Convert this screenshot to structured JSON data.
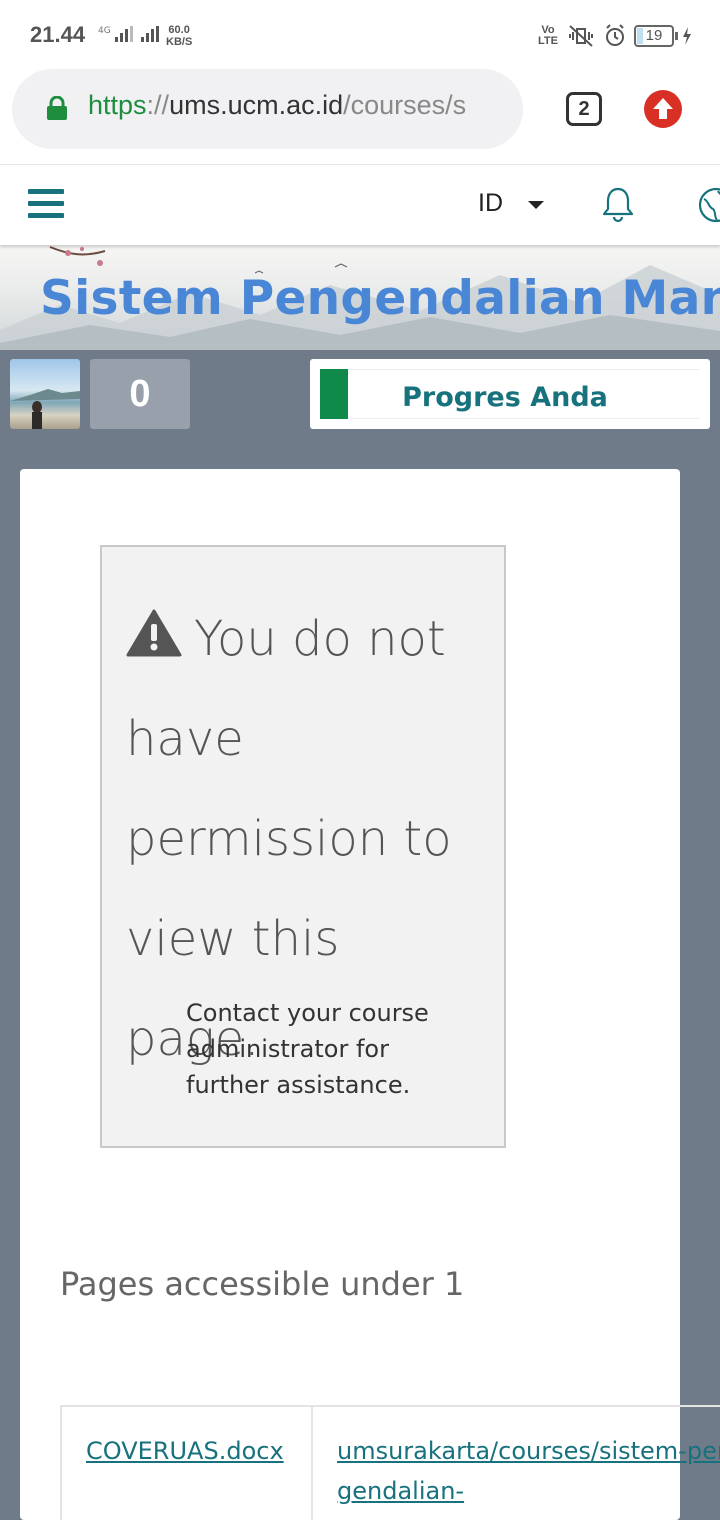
{
  "status_bar": {
    "time": "21.44",
    "network_type": "4G",
    "speed_value": "60.0",
    "speed_unit": "KB/S",
    "volte_top": "Vo",
    "volte_bottom": "LTE",
    "battery_level": "19"
  },
  "browser": {
    "url_scheme": "https",
    "url_separator": "://",
    "url_host": "ums.ucm.ac.id",
    "url_path": "/courses/s",
    "tab_count": "2"
  },
  "site_nav": {
    "language": "ID"
  },
  "banner": {
    "title": "Sistem Pengendalian Manaje"
  },
  "user_strip": {
    "points": "0",
    "progress_label": "Progres Anda",
    "progress_color": "#108a4a"
  },
  "main": {
    "warning_title": "You do not have permission to view this page.",
    "warning_subtitle": "Contact your course administrator for further assistance.",
    "pages_heading": "Pages accessible under 1",
    "table_rows": [
      {
        "file": "COVERUAS.docx",
        "path": "umsurakarta/courses/sistem-pengendalian-"
      }
    ]
  },
  "colors": {
    "accent": "#17727d",
    "banner_title": "#4a86d6",
    "strip_background": "#707b8a",
    "secure_green": "#1e8e3e",
    "update_red": "#d93025"
  }
}
